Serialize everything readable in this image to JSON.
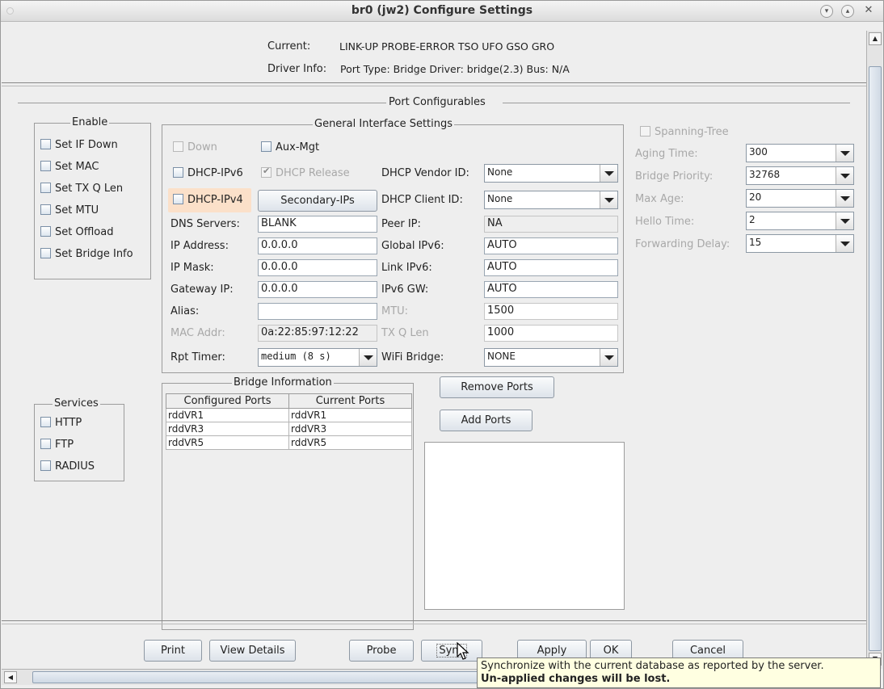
{
  "window": {
    "title": "br0  (jw2) Configure Settings"
  },
  "header": {
    "current_label": "Current:",
    "current_value": "LINK-UP PROBE-ERROR TSO UFO GSO GRO",
    "driver_label": "Driver Info:",
    "driver_value": "Port Type: Bridge   Driver: bridge(2.3)  Bus: N/A"
  },
  "section_title": "Port Configurables",
  "enable_group": {
    "title": "Enable",
    "items": [
      "Set IF Down",
      "Set MAC",
      "Set TX Q Len",
      "Set MTU",
      "Set Offload",
      "Set Bridge Info"
    ]
  },
  "services_group": {
    "title": "Services",
    "items": [
      "HTTP",
      "FTP",
      "RADIUS"
    ]
  },
  "general": {
    "title": "General Interface Settings",
    "down": "Down",
    "aux_mgt": "Aux-Mgt",
    "dhcp_ipv6": "DHCP-IPv6",
    "dhcp_release": "DHCP Release",
    "dhcp_vendor_label": "DHCP Vendor ID:",
    "dhcp_vendor_value": "None",
    "dhcp_ipv4": "DHCP-IPv4",
    "secondary_ips": "Secondary-IPs",
    "dhcp_client_label": "DHCP Client ID:",
    "dhcp_client_value": "None",
    "dns_label": "DNS Servers:",
    "dns_value": "BLANK",
    "peer_ip_label": "Peer IP:",
    "peer_ip_value": "NA",
    "ip_label": "IP Address:",
    "ip_value": "0.0.0.0",
    "global_ipv6_label": "Global IPv6:",
    "global_ipv6_value": "AUTO",
    "mask_label": "IP Mask:",
    "mask_value": "0.0.0.0",
    "link_ipv6_label": "Link IPv6:",
    "link_ipv6_value": "AUTO",
    "gw_label": "Gateway IP:",
    "gw_value": "0.0.0.0",
    "ipv6gw_label": "IPv6 GW:",
    "ipv6gw_value": "AUTO",
    "alias_label": "Alias:",
    "alias_value": "",
    "mtu_label": "MTU:",
    "mtu_value": "1500",
    "mac_label": "MAC Addr:",
    "mac_value": "0a:22:85:97:12:22",
    "txq_label": "TX Q Len",
    "txq_value": "1000",
    "rpt_label": "Rpt Timer:",
    "rpt_value": "medium  (8 s)",
    "wifi_label": "WiFi Bridge:",
    "wifi_value": "NONE"
  },
  "stp": {
    "spanning_tree": "Spanning-Tree",
    "aging_label": "Aging Time:",
    "aging_value": "300",
    "priority_label": "Bridge Priority:",
    "priority_value": "32768",
    "maxage_label": "Max Age:",
    "maxage_value": "20",
    "hello_label": "Hello Time:",
    "hello_value": "2",
    "fwd_label": "Forwarding Delay:",
    "fwd_value": "15"
  },
  "bridge": {
    "title": "Bridge Information",
    "col_configured": "Configured Ports",
    "col_current": "Current Ports",
    "rows": [
      {
        "configured": "rddVR1",
        "current": "rddVR1"
      },
      {
        "configured": "rddVR3",
        "current": "rddVR3"
      },
      {
        "configured": "rddVR5",
        "current": "rddVR5"
      }
    ],
    "remove_ports": "Remove Ports",
    "add_ports": "Add Ports"
  },
  "buttons": {
    "print": "Print",
    "view_details": "View Details",
    "probe": "Probe",
    "sync": "Sync",
    "apply": "Apply",
    "ok": "OK",
    "cancel": "Cancel"
  },
  "tooltip": {
    "line1": "Synchronize with the current database as reported by the server.",
    "line2": "Un-applied changes will be lost."
  },
  "colors": {
    "highlight_dhcp_ipv4": "#fbe0c9",
    "tooltip_bg": "#ffffe1"
  }
}
